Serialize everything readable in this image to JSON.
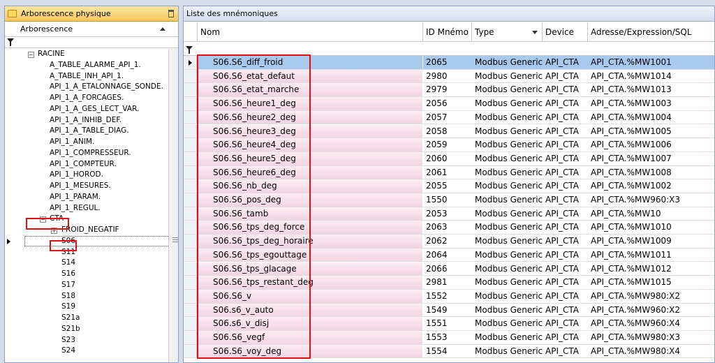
{
  "left_panel": {
    "title": "Arborescence physique",
    "column_header": "Arborescence",
    "tree": [
      {
        "label": "RACINE",
        "level": 0,
        "expander": "minus"
      },
      {
        "label": "A_TABLE_ALARME_API_1.",
        "level": 1
      },
      {
        "label": "A_TABLE_INH_API_1.",
        "level": 1
      },
      {
        "label": "API_1_A_ETALONNAGE_SONDE.",
        "level": 1
      },
      {
        "label": "API_1_A_FORCAGES.",
        "level": 1
      },
      {
        "label": "API_1_A_GES_LECT_VAR.",
        "level": 1
      },
      {
        "label": "API_1_A_INHIB_DEF.",
        "level": 1
      },
      {
        "label": "API_1_A_TABLE_DIAG.",
        "level": 1
      },
      {
        "label": "API_1_ANIM.",
        "level": 1
      },
      {
        "label": "API_1_COMPRESSEUR.",
        "level": 1
      },
      {
        "label": "API_1_COMPTEUR.",
        "level": 1
      },
      {
        "label": "API_1_HOROD.",
        "level": 1
      },
      {
        "label": "API_1_MESURES.",
        "level": 1
      },
      {
        "label": "API_1_PARAM.",
        "level": 1
      },
      {
        "label": "API_1_REGUL.",
        "level": 1
      },
      {
        "label": "CTA",
        "level": 1,
        "expander": "minus"
      },
      {
        "label": "FROID_NEGATIF",
        "level": 2,
        "expander": "plus"
      },
      {
        "label": "S06",
        "level": 2,
        "selected": true
      },
      {
        "label": "S11",
        "level": 2
      },
      {
        "label": "S14",
        "level": 2
      },
      {
        "label": "S16",
        "level": 2
      },
      {
        "label": "S17",
        "level": 2
      },
      {
        "label": "S18",
        "level": 2
      },
      {
        "label": "S19",
        "level": 2
      },
      {
        "label": "S21a",
        "level": 2
      },
      {
        "label": "S21b",
        "level": 2
      },
      {
        "label": "S23",
        "level": 2
      },
      {
        "label": "S24",
        "level": 2
      }
    ]
  },
  "right_panel": {
    "title": "Liste des mnémoniques",
    "columns": [
      "Nom",
      "ID Mnémo",
      "Type",
      "Device",
      "Adresse/Expression/SQL"
    ],
    "rows": [
      [
        "S06.S6_diff_froid",
        "2065",
        "Modbus Generic",
        "API_CTA",
        "API_CTA.%MW1001"
      ],
      [
        "S06.S6_etat_defaut",
        "2980",
        "Modbus Generic",
        "API_CTA",
        "API_CTA.%MW1014"
      ],
      [
        "S06.S6_etat_marche",
        "2979",
        "Modbus Generic",
        "API_CTA",
        "API_CTA.%MW1013"
      ],
      [
        "S06.S6_heure1_deg",
        "2056",
        "Modbus Generic",
        "API_CTA",
        "API_CTA.%MW1003"
      ],
      [
        "S06.S6_heure2_deg",
        "2057",
        "Modbus Generic",
        "API_CTA",
        "API_CTA.%MW1004"
      ],
      [
        "S06.S6_heure3_deg",
        "2058",
        "Modbus Generic",
        "API_CTA",
        "API_CTA.%MW1005"
      ],
      [
        "S06.S6_heure4_deg",
        "2059",
        "Modbus Generic",
        "API_CTA",
        "API_CTA.%MW1006"
      ],
      [
        "S06.S6_heure5_deg",
        "2060",
        "Modbus Generic",
        "API_CTA",
        "API_CTA.%MW1007"
      ],
      [
        "S06.S6_heure6_deg",
        "2061",
        "Modbus Generic",
        "API_CTA",
        "API_CTA.%MW1008"
      ],
      [
        "S06.S6_nb_deg",
        "2055",
        "Modbus Generic",
        "API_CTA",
        "API_CTA.%MW1002"
      ],
      [
        "S06.S6_pos_deg",
        "1550",
        "Modbus Generic",
        "API_CTA",
        "API_CTA.%MW960:X3"
      ],
      [
        "S06.S6_tamb",
        "2053",
        "Modbus Generic",
        "API_CTA",
        "API_CTA.%MW10"
      ],
      [
        "S06.S6_tps_deg_force",
        "2063",
        "Modbus Generic",
        "API_CTA",
        "API_CTA.%MW1010"
      ],
      [
        "S06.S6_tps_deg_horaire",
        "2062",
        "Modbus Generic",
        "API_CTA",
        "API_CTA.%MW1009"
      ],
      [
        "S06.S6_tps_egouttage",
        "2064",
        "Modbus Generic",
        "API_CTA",
        "API_CTA.%MW1011"
      ],
      [
        "S06.S6_tps_glacage",
        "2066",
        "Modbus Generic",
        "API_CTA",
        "API_CTA.%MW1012"
      ],
      [
        "S06.S6_tps_restant_deg",
        "2981",
        "Modbus Generic",
        "API_CTA",
        "API_CTA.%MW1015"
      ],
      [
        "S06.S6_v",
        "1552",
        "Modbus Generic",
        "API_CTA",
        "API_CTA.%MW980:X2"
      ],
      [
        "S06.s6_v_auto",
        "1549",
        "Modbus Generic",
        "API_CTA",
        "API_CTA.%MW960:X2"
      ],
      [
        "S06.s6_v_disj",
        "1551",
        "Modbus Generic",
        "API_CTA",
        "API_CTA.%MW960:X4"
      ],
      [
        "S06.S6_vegf",
        "1553",
        "Modbus Generic",
        "API_CTA",
        "API_CTA.%MW980:X3"
      ],
      [
        "S06.S6_voy_deg",
        "1554",
        "Modbus Generic",
        "API_CTA",
        "API_CTA.%MW980:X4"
      ]
    ]
  },
  "colors": {
    "highlight_red": "#e01010",
    "selected_row": "#a9c8ee",
    "name_cell_tint": "#f1d5e2"
  }
}
